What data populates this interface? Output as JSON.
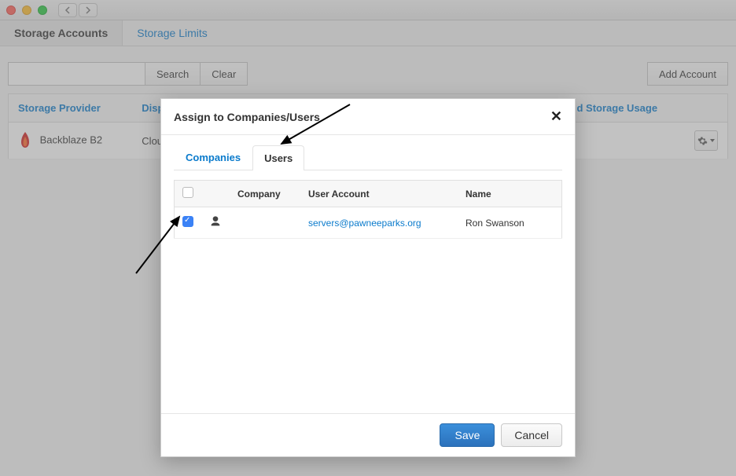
{
  "main_tabs": {
    "storage_accounts": "Storage Accounts",
    "storage_limits": "Storage Limits"
  },
  "toolbar": {
    "search_label": "Search",
    "clear_label": "Clear",
    "search_placeholder": "",
    "add_account_label": "Add Account"
  },
  "table": {
    "headers": {
      "provider": "Storage Provider",
      "display": "Disp",
      "cloud_usage_suffix": "d Storage Usage"
    },
    "rows": [
      {
        "provider": "Backblaze B2",
        "display": "Clou"
      }
    ]
  },
  "dialog": {
    "title": "Assign to Companies/Users",
    "tabs": {
      "companies": "Companies",
      "users": "Users"
    },
    "user_table": {
      "headers": {
        "company": "Company",
        "user_account": "User Account",
        "name": "Name"
      },
      "rows": [
        {
          "checked": true,
          "company": "",
          "user_account": "servers@pawneeparks.org",
          "name": "Ron Swanson"
        }
      ]
    },
    "buttons": {
      "save": "Save",
      "cancel": "Cancel"
    }
  }
}
